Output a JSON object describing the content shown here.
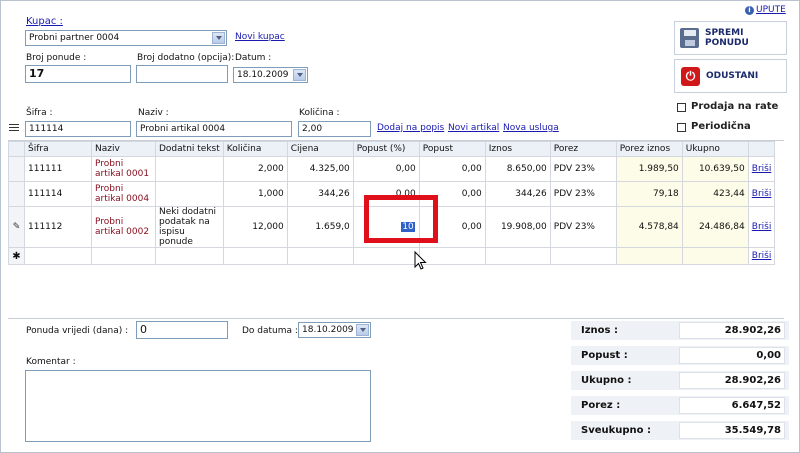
{
  "header": {
    "upute": "UPUTE",
    "kupac_label": "Kupac :",
    "kupac_value": "Probni partner 0004",
    "novi_kupac": "Novi kupac",
    "broj_ponude_label": "Broj ponude :",
    "broj_ponude_value": "17",
    "broj_dodatno_label": "Broj dodatno (opcija):",
    "broj_dodatno_value": "",
    "datum_label": "Datum :",
    "datum_value": "18.10.2009"
  },
  "actions": {
    "save": "SPREMI PONUDU",
    "cancel": "ODUSTANI",
    "prodaja_na_rate": "Prodaja na rate",
    "periodicna": "Periodična"
  },
  "entry": {
    "sifra_label": "Šifra :",
    "sifra_value": "111114",
    "naziv_label": "Naziv :",
    "naziv_value": "Probni artikal 0004",
    "kolicina_label": "Količina :",
    "kolicina_value": "2,00",
    "dodaj": "Dodaj na popis",
    "novi_artikal": "Novi artikal",
    "nova_usluga": "Nova usluga"
  },
  "grid": {
    "columns": [
      "Šifra",
      "Naziv",
      "Dodatni tekst",
      "Količina",
      "Cijena",
      "Popust (%)",
      "Popust",
      "Iznos",
      "Porez",
      "Porez iznos",
      "Ukupno"
    ],
    "rows": [
      {
        "sifra": "111111",
        "naziv": "Probni artikal 0001",
        "dodatni": "",
        "kolicina": "2,000",
        "cijena": "4.325,00",
        "popust_pct": "0,00",
        "popust": "0,00",
        "iznos": "8.650,00",
        "porez": "PDV 23%",
        "porez_iznos": "1.989,50",
        "ukupno": "10.639,50",
        "brisi": "Briši"
      },
      {
        "sifra": "111114",
        "naziv": "Probni artikal 0004",
        "dodatni": "",
        "kolicina": "1,000",
        "cijena": "344,26",
        "popust_pct": "0,00",
        "popust": "0,00",
        "iznos": "344,26",
        "porez": "PDV 23%",
        "porez_iznos": "79,18",
        "ukupno": "423,44",
        "brisi": "Briši"
      },
      {
        "sifra": "111112",
        "naziv": "Probni artikal 0002",
        "dodatni": "Neki dodatni podatak na ispisu ponude",
        "kolicina": "12,000",
        "cijena": "1.659,0",
        "popust_pct": "10",
        "popust": "0,00",
        "iznos": "19.908,00",
        "porez": "PDV 23%",
        "porez_iznos": "4.578,84",
        "ukupno": "24.486,84",
        "brisi": "Briši"
      }
    ],
    "new_row_brisi": "Briši"
  },
  "footer": {
    "ponuda_label": "Ponuda vrijedi (dana) :",
    "ponuda_value": "0",
    "do_datuma_label": "Do datuma :",
    "do_datuma_value": "18.10.2009",
    "komentar_label": "Komentar :",
    "komentar_value": ""
  },
  "totals": {
    "iznos_label": "Iznos :",
    "iznos": "28.902,26",
    "popust_label": "Popust :",
    "popust": "0,00",
    "ukupno_label": "Ukupno :",
    "ukupno": "28.902,26",
    "porez_label": "Porez :",
    "porez": "6.647,52",
    "sveukupno_label": "Sveukupno :",
    "sveukupno": "35.549,78"
  },
  "colors": {
    "link": "#1a1ab0",
    "highlight": "#e0101a",
    "cancel_icon": "#d01818"
  }
}
